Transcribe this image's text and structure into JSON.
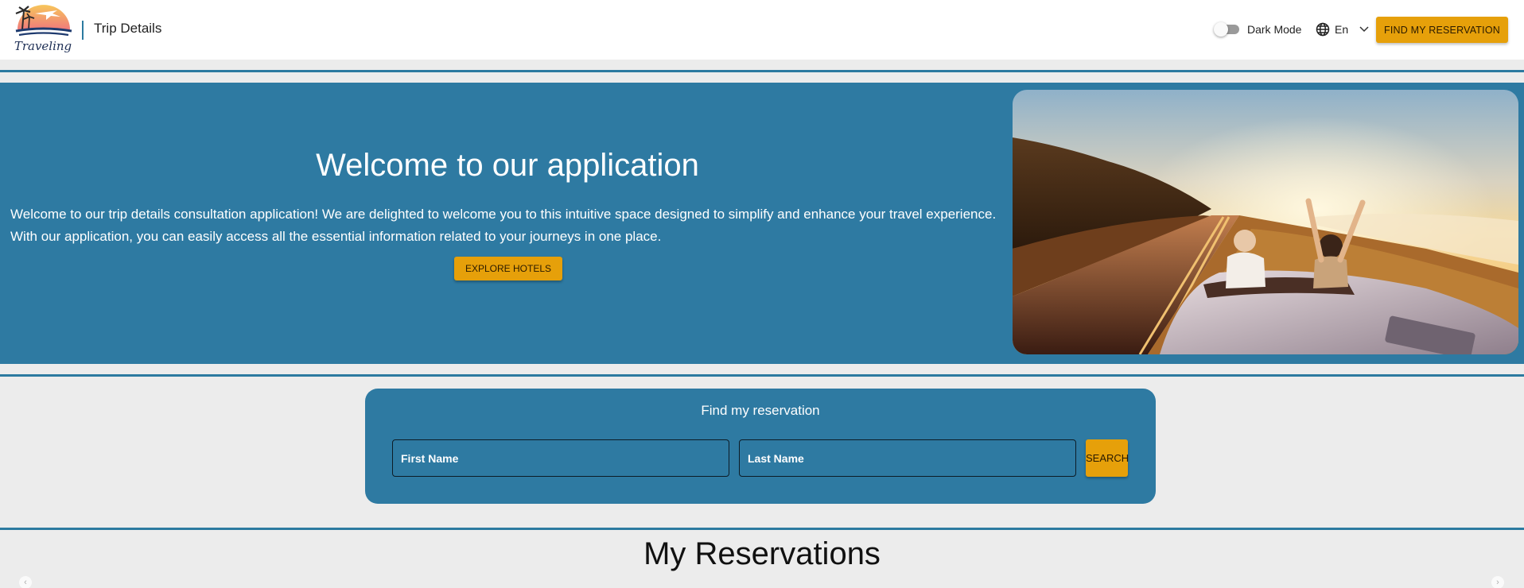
{
  "header": {
    "logo_text": "Traveling",
    "title": "Trip Details",
    "dark_mode_label": "Dark Mode",
    "dark_mode_on": false,
    "language": "En",
    "find_button": "FIND MY RESERVATION"
  },
  "hero": {
    "title": "Welcome to our application",
    "text": "Welcome to our trip details consultation application! We are delighted to welcome you to this intuitive space designed to simplify and enhance your travel experience. With our application, you can easily access all the essential information related to your journeys in one place.",
    "button": "EXPLORE HOTELS"
  },
  "search": {
    "title": "Find my reservation",
    "first_name": "First Name",
    "last_name": "Last Name",
    "button": "SEARCH"
  },
  "reservations": {
    "title": "My Reservations"
  },
  "colors": {
    "primary": "#2e7aa2",
    "accent": "#e6a00a",
    "background": "#ececec"
  }
}
